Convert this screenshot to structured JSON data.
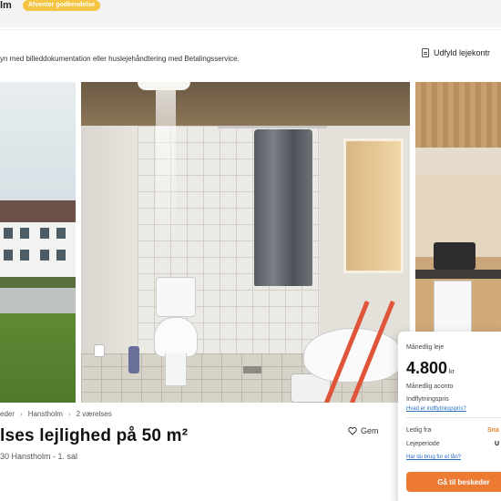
{
  "header": {
    "title_fragment": "lm",
    "badge": "Afventer godkendelse"
  },
  "banner": {
    "text": "yn med billeddokumentation eller huslejehåndtering med Betalingsservice.",
    "fill_button": "Udfyld lejekontr"
  },
  "gallery": {
    "photos": [
      "building-exterior",
      "bathroom",
      "kitchen"
    ]
  },
  "breadcrumbs": [
    "eder",
    "Hanstholm",
    "2 værelses"
  ],
  "listing": {
    "title": "lses lejlighed på 50 m²",
    "address": "30 Hanstholm - 1. sal",
    "save_label": "Gem"
  },
  "price_card": {
    "monthly_rent_label": "Månedlig leje",
    "rent_value": "4.800",
    "currency": "kr",
    "aconto_label": "Månedlig aconto",
    "deposit_label": "Indflytningspris",
    "deposit_link": "Hvad er indflytningspris?",
    "available_label": "Ledig fra",
    "available_value": "Sna",
    "period_label": "Lejeperiode",
    "period_value": "U",
    "why_link": "Har du brug for et lån?",
    "cta": "Gå til beskeder"
  },
  "colors": {
    "accent": "#ec7a33",
    "badge": "#f4c542",
    "link": "#2a6ec6"
  }
}
